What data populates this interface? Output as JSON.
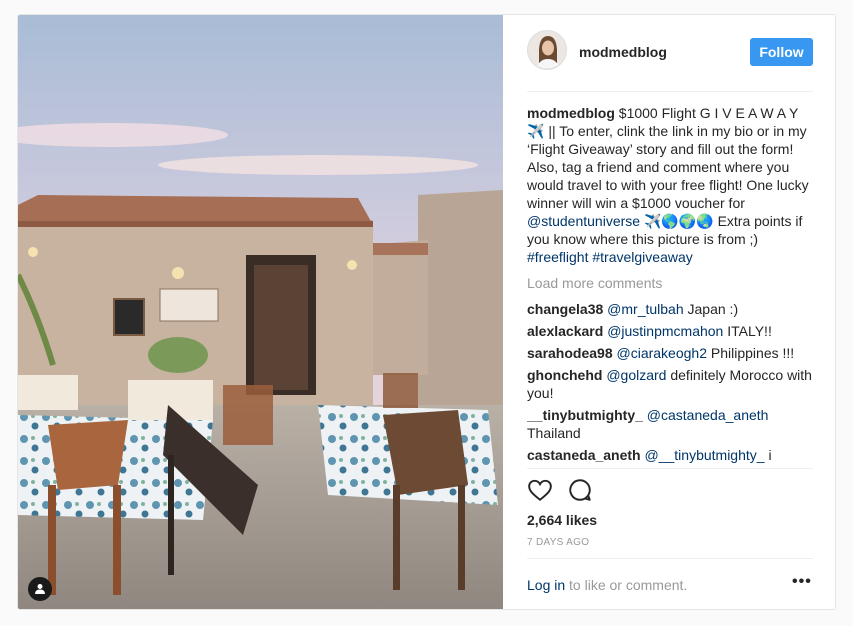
{
  "post": {
    "username": "modmedblog",
    "follow_label": "Follow"
  },
  "caption": {
    "username": "modmedblog",
    "text_1": "$1000 Flight G I V E A W A Y ✈️ || To enter, clink the link in my bio or in my ‘Flight Giveaway’ story and fill out the form! Also, tag a friend and comment where you would travel to with your free flight! One lucky winner will win a $1000 voucher for ",
    "mention": "@studentuniverse",
    "text_2": " ✈️🌎🌍🌏 Extra points if you know where this picture is from ;) ",
    "hashtag_1": "#freeflight",
    "hashtag_2": "#travelgiveaway"
  },
  "load_more_label": "Load more comments",
  "comments": [
    {
      "user": "changela38",
      "mention": "@mr_tulbah",
      "text": " Japan :)"
    },
    {
      "user": "alexlackard",
      "mention": "@justinpmcmahon",
      "text": " ITALY!!"
    },
    {
      "user": "sarahodea98",
      "mention": "@ciarakeogh2",
      "text": " Philippines !!!"
    },
    {
      "user": "ghonchehd",
      "mention": "@golzard",
      "text": " definitely Morocco with you!"
    },
    {
      "user": "__tinybutmighty_",
      "mention": "@castaneda_aneth",
      "text": " Thailand"
    },
    {
      "user": "castaneda_aneth",
      "mention": "@__tinybutmighty_",
      "text": " i"
    }
  ],
  "likes_text": "2,664 likes",
  "time_text": "7 DAYS AGO",
  "footer": {
    "login_label": "Log in",
    "rest": " to like or comment.",
    "more_label": "•••"
  },
  "icons": {
    "heart": "heart-icon",
    "comment": "comment-icon",
    "more": "more-options-icon",
    "user_tag": "user-tag-icon"
  },
  "colors": {
    "follow_button": "#3897f0",
    "link": "#003569",
    "muted": "#999999"
  }
}
